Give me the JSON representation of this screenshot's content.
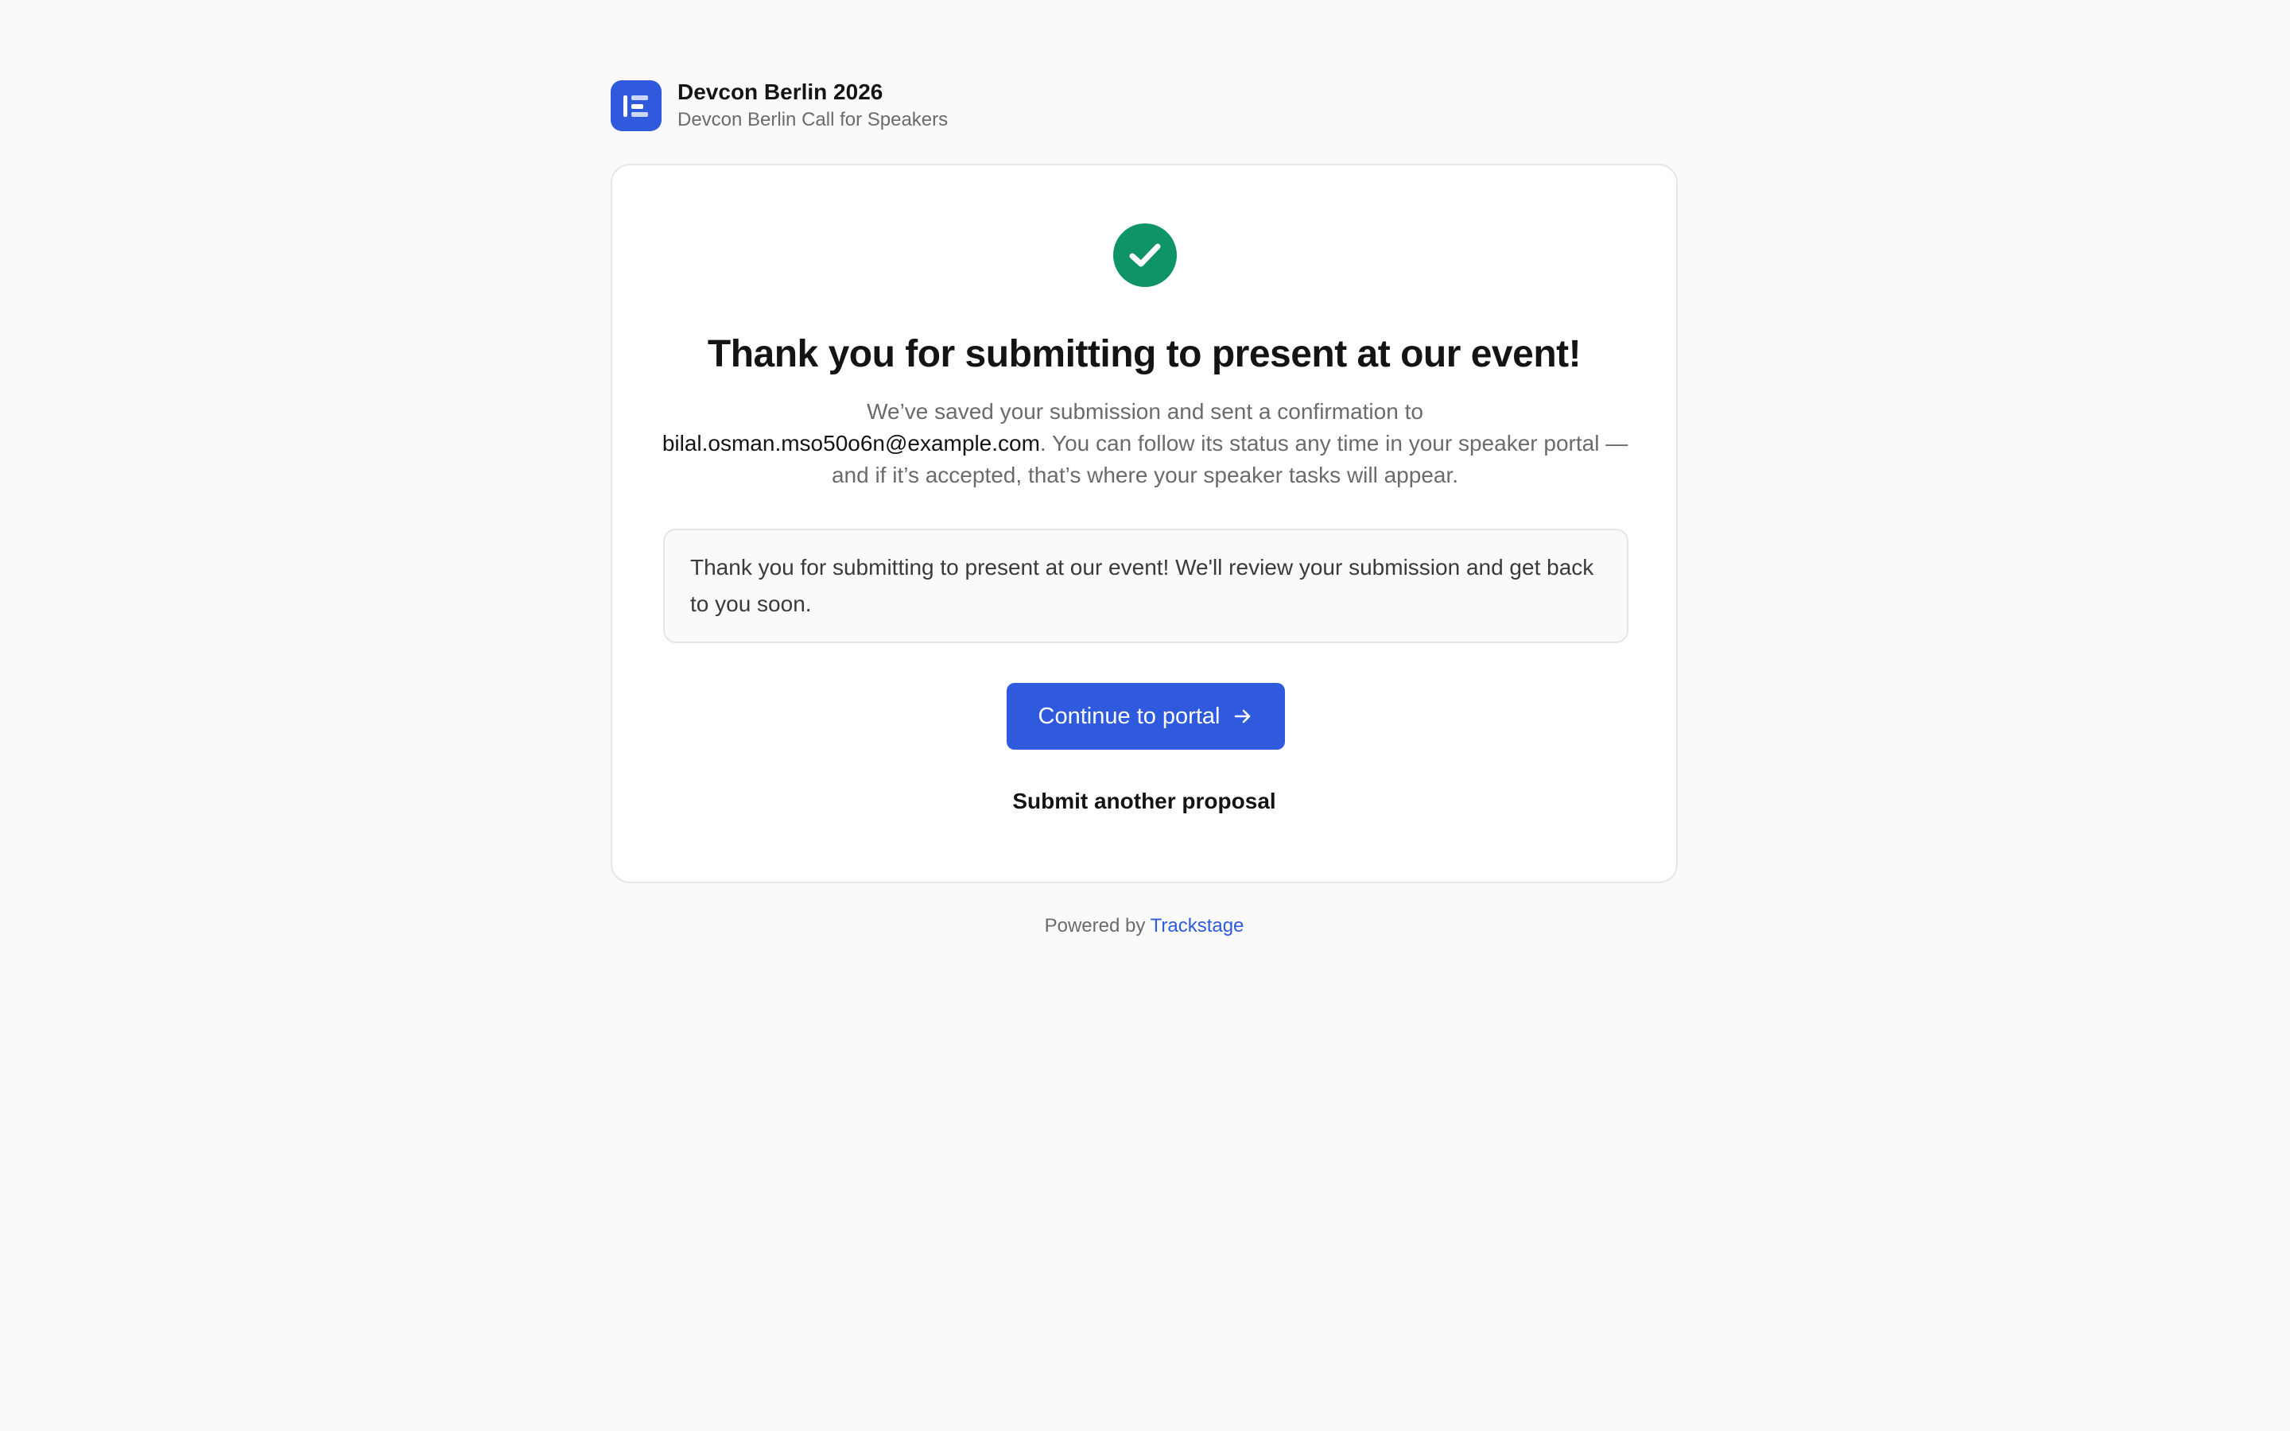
{
  "header": {
    "logo_icon": "event-logo-icon",
    "org_name": "Devcon Berlin 2026",
    "subtitle": "Devcon Berlin Call for Speakers"
  },
  "confirmation": {
    "status_icon": "check-circle-icon",
    "status_color": "#0f9467",
    "title": "Thank you for submitting to present at our event!",
    "lead_before": "We’ve saved your submission and sent a confirmation to",
    "email": "bilal.osman.mso50o6n@example.com",
    "lead_after": ". You can follow its status any time in your speaker portal — and if it’s accepted, that’s where your speaker tasks will appear.",
    "message": "Thank you for submitting to present at our event! We'll review your submission and get back to you soon.",
    "primary_button": {
      "label": "Continue to portal",
      "icon": "arrow-right-icon",
      "color": "#2f5ade"
    },
    "secondary_link": "Submit another proposal"
  },
  "footer": {
    "powered_by": "Powered by",
    "brand": "Trackstage"
  }
}
